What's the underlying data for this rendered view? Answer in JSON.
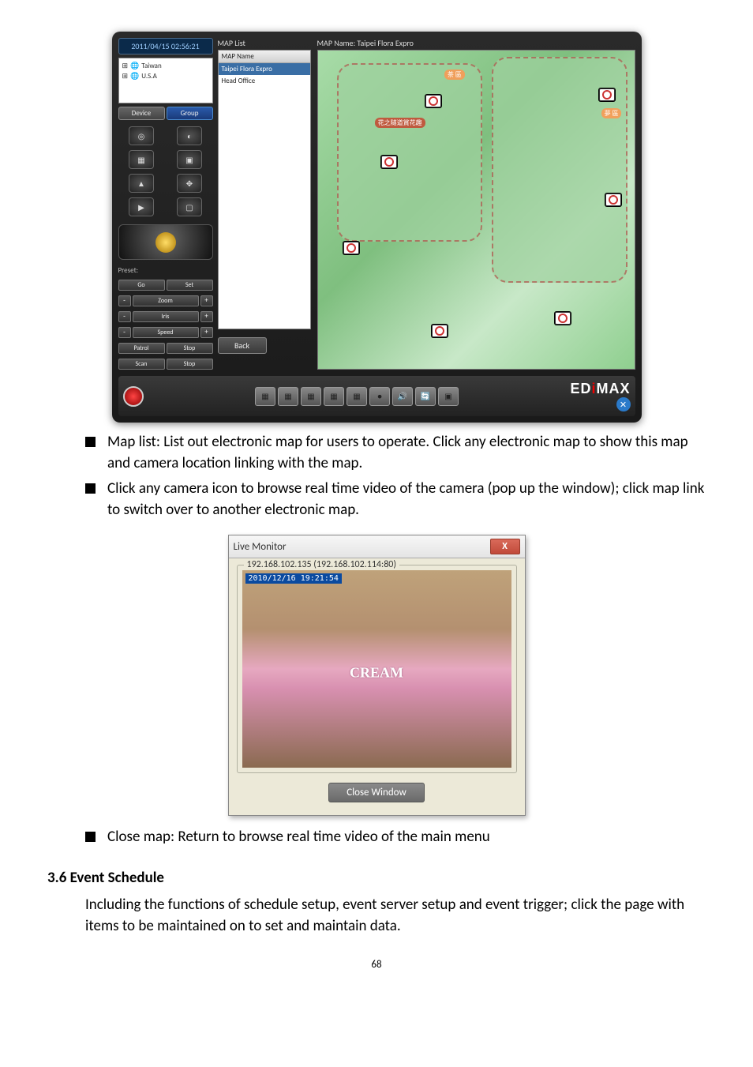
{
  "app": {
    "timestamp": "2011/04/15 02:56:21",
    "tree": {
      "items": [
        "Taiwan",
        "U.S.A"
      ]
    },
    "tabs": {
      "device": "Device",
      "group": "Group"
    },
    "preset_label": "Preset:",
    "buttons": {
      "go": "Go",
      "set": "Set",
      "zoom": "Zoom",
      "iris": "Iris",
      "speed": "Speed",
      "patrol": "Patrol",
      "scan": "Scan",
      "stop": "Stop"
    },
    "maplist": {
      "title": "MAP List",
      "header": "MAP Name",
      "items": [
        "Taipei Flora Expro",
        "Head Office"
      ]
    },
    "back": "Back",
    "mapname_label": "MAP Name:",
    "mapname_value": "Taipei Flora Expro",
    "badges": {
      "tea": "茶 區",
      "hua": "花之隧道賞花趣",
      "dream": "夢 區"
    },
    "brand": "EDIMAX"
  },
  "bullets1": [
    "Map list: List out electronic map for users to operate. Click any electronic map to show this map and camera location linking with the map.",
    "Click any camera icon to browse real time video of the camera (pop up the window); click map link to switch over to another electronic map."
  ],
  "live": {
    "title": "Live Monitor",
    "legend": "192.168.102.135 (192.168.102.114:80)",
    "timestamp": "2010/12/16 19:21:54",
    "overlay": "CREAM",
    "close": "Close Window"
  },
  "bullets2": [
    "Close map: Return to browse real time video of the main menu"
  ],
  "section": "3.6 Event Schedule",
  "para": "Including the functions of schedule setup, event server setup and event trigger; click the page with items to be maintained on to set and maintain data.",
  "pagenum": "68"
}
